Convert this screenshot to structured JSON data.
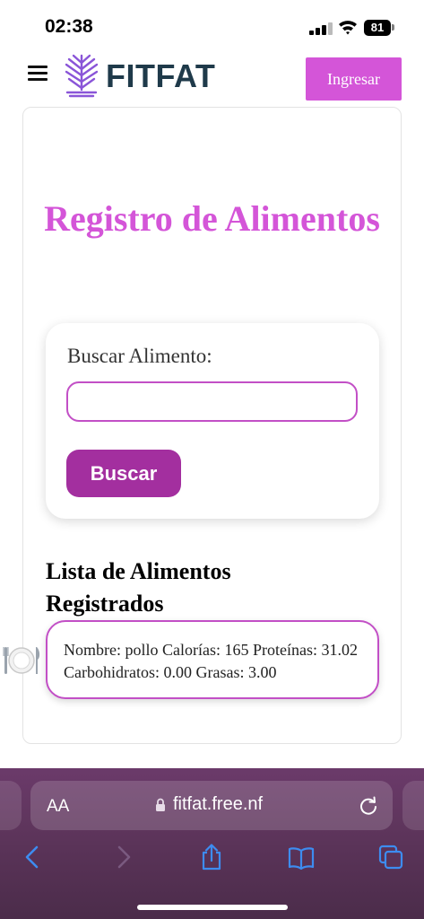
{
  "status": {
    "time": "02:38",
    "battery": "81"
  },
  "header": {
    "brand": "FITFAT",
    "login_label": "Ingresar",
    "logo_icon": "leaf-logo-icon",
    "menu_icon": "hamburger-icon"
  },
  "main": {
    "title": "Registro de Alimentos",
    "search": {
      "label": "Buscar Alimento:",
      "value": "",
      "button_label": "Buscar"
    },
    "list": {
      "heading": "Lista de Alimentos Registrados",
      "items": [
        {
          "text": "Nombre: pollo Calorías: 165 Proteínas: 31.02 Carbohidratos: 0.00 Grasas: 3.00",
          "icon": "plate-cutlery-icon"
        }
      ]
    }
  },
  "browser": {
    "url": "fitfat.free.nf",
    "text_size_label": "AA",
    "icons": [
      "back-icon",
      "forward-icon",
      "share-icon",
      "bookmarks-icon",
      "tabs-icon",
      "reload-icon",
      "lock-icon"
    ]
  },
  "colors": {
    "accent": "#d455d8",
    "button": "#a32f9f",
    "brand_text": "#1f3a4a",
    "browser_bar": "#5e355c"
  }
}
